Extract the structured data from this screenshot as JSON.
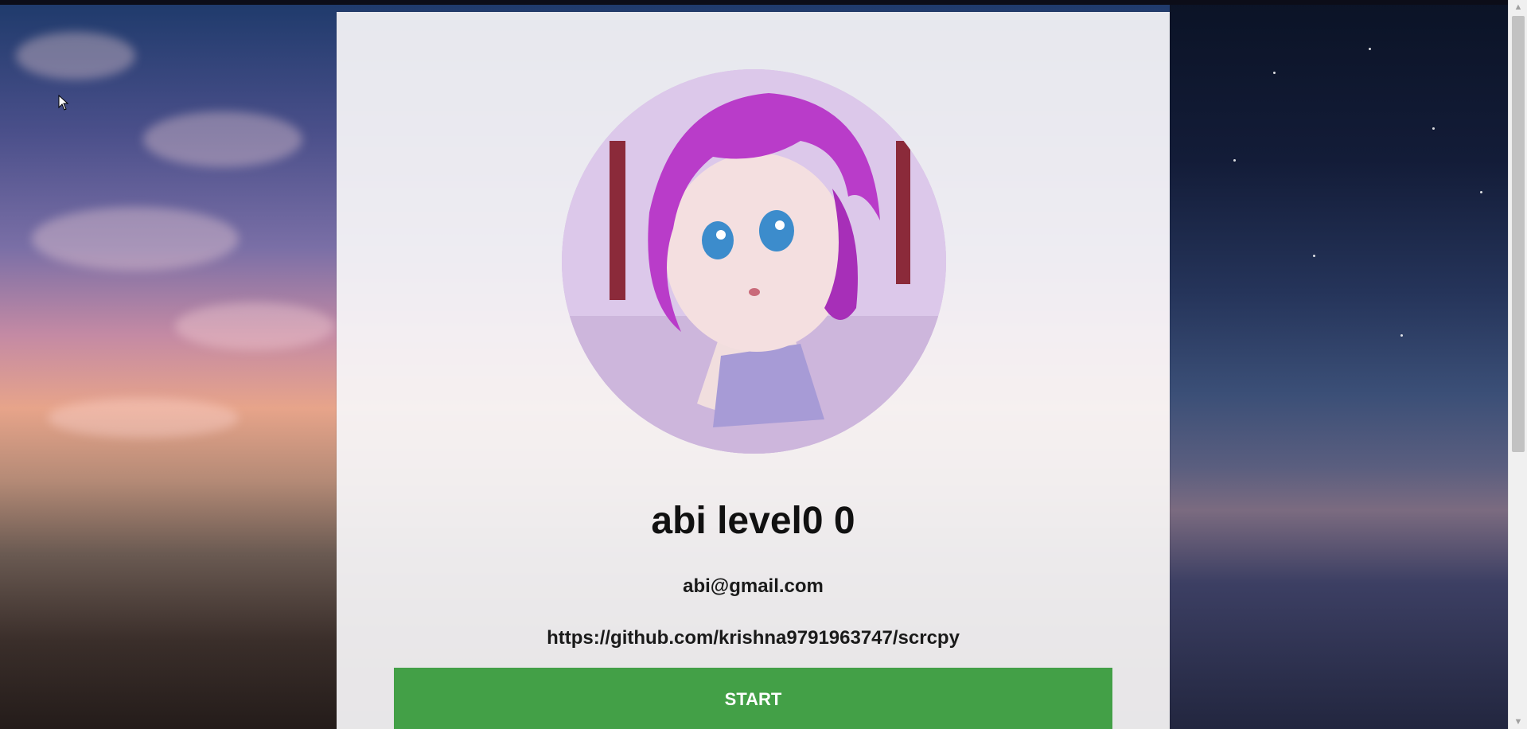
{
  "profile": {
    "name": "abi level0 0",
    "email": "abi@gmail.com",
    "link": "https://github.com/krishna9791963747/scrcpy"
  },
  "actions": {
    "start_label": "START"
  },
  "scrollbar": {
    "up_arrow": "▲",
    "down_arrow": "▼"
  },
  "colors": {
    "start_button": "#43a047",
    "panel": "#f6f5f7"
  },
  "icons": {
    "cursor": "mouse-pointer-icon",
    "avatar": "profile-avatar-image"
  }
}
